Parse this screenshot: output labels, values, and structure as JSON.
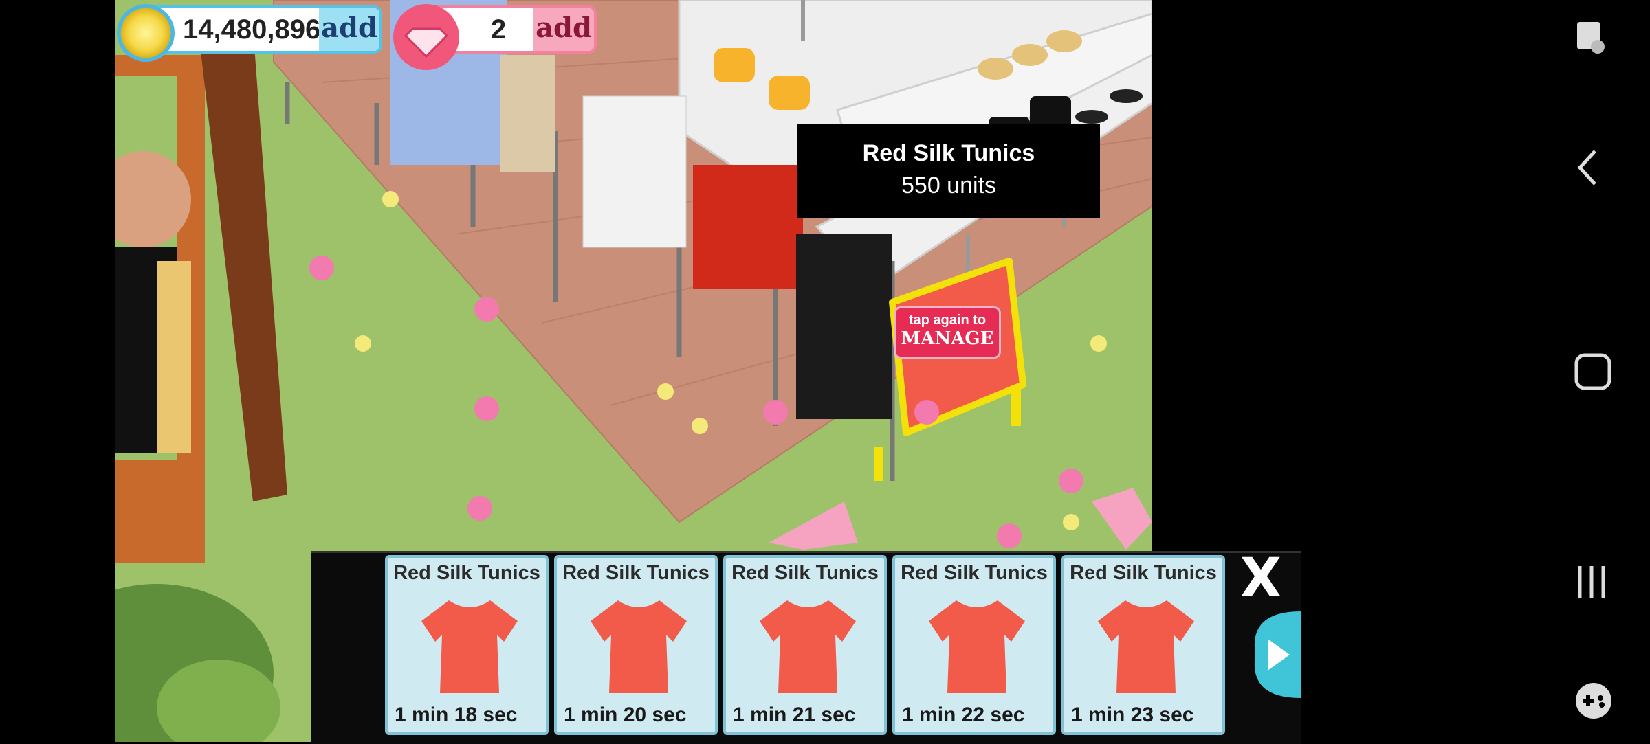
{
  "currency": {
    "coins": "14,480,896",
    "coins_add": "add",
    "gems": "2",
    "gems_add": "add"
  },
  "tooltip": {
    "title": "Red Silk Tunics",
    "subtitle": "550 units"
  },
  "rack_sign": {
    "line1": "tap again to",
    "line2": "MANAGE"
  },
  "panel": {
    "close_label": "X",
    "items": [
      {
        "name": "Red Silk Tunics",
        "timer": "1 min 18 sec"
      },
      {
        "name": "Red Silk Tunics",
        "timer": "1 min 20 sec"
      },
      {
        "name": "Red Silk Tunics",
        "timer": "1 min 21 sec"
      },
      {
        "name": "Red Silk Tunics",
        "timer": "1 min 22 sec"
      },
      {
        "name": "Red Silk Tunics",
        "timer": "1 min 23 sec"
      }
    ]
  },
  "colors": {
    "tunic": "#f25a4a",
    "grass": "#9dc26a",
    "floor": "#c98f78"
  },
  "icons": {
    "nav": [
      "screen-lock-icon",
      "back-icon",
      "home-icon",
      "recents-icon",
      "game-launcher-icon"
    ]
  }
}
